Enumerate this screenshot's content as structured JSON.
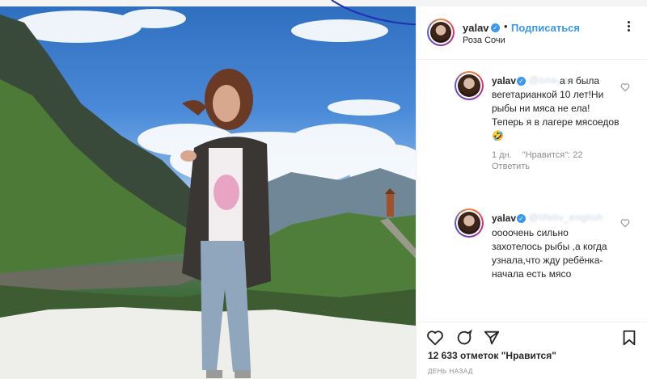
{
  "post": {
    "username": "yalav",
    "follow_label": "Подписаться",
    "location": "Роза Сочи",
    "likes_text": "12 633 отметок \"Нравится\"",
    "date_text": "ДЕНЬ НАЗАД"
  },
  "comments": [
    {
      "username": "yalav",
      "mention": "@ола_а",
      "text": "а я была вегетарианкой 10 лет!Ни рыбы ни мяса не ела!Теперь я в лагере мясоедов🤣",
      "age": "1 дн.",
      "likes": "\"Нравится\": 22",
      "reply_label": "Ответить"
    },
    {
      "username": "yalav",
      "mention": "@lifeliv_english",
      "text": "оооочень сильно захотелось рыбы ,а когда узнала,что жду ребёнка-начала есть мясо"
    }
  ],
  "icons": {
    "more": "more-dots-icon",
    "verified": "verified-badge-icon",
    "heart": "heart-outline-icon",
    "comment": "comment-icon",
    "share": "share-icon",
    "save": "bookmark-icon"
  },
  "colors": {
    "link_blue": "#3897f0",
    "text": "#262626",
    "muted": "#8e8e8e",
    "annotation_line": "#1f2fb0"
  }
}
